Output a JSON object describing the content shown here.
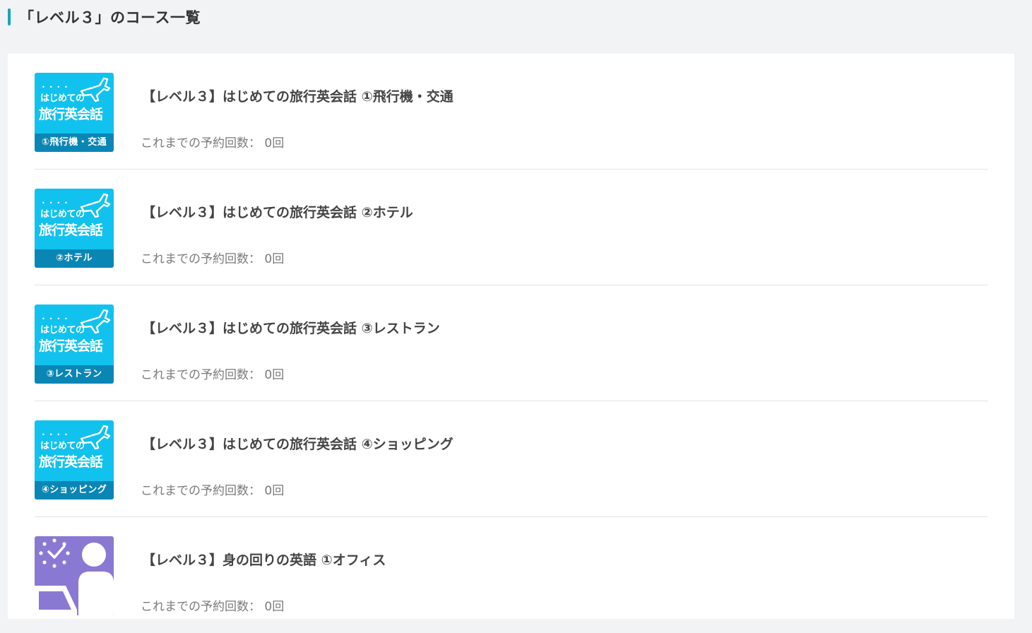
{
  "header": {
    "title": "「レベル３」のコース一覧"
  },
  "colors": {
    "accent": "#1aa3b8",
    "travel_thumb": "#12c2ee",
    "travel_band": "#0a86b5",
    "office_thumb": "#8a79d3"
  },
  "courses": [
    {
      "title": "【レベル３】はじめての旅行英会話 ①飛行機・交通",
      "reservations_label": "これまでの予約回数：",
      "reservations_count": "0回",
      "thumb": {
        "type": "travel",
        "top": "はじめての",
        "main": "旅行英会話",
        "band": "①飛行機・交通",
        "icon": "airplane-icon"
      }
    },
    {
      "title": "【レベル３】はじめての旅行英会話 ②ホテル",
      "reservations_label": "これまでの予約回数：",
      "reservations_count": "0回",
      "thumb": {
        "type": "travel",
        "top": "はじめての",
        "main": "旅行英会話",
        "band": "②ホテル",
        "icon": "airplane-icon"
      }
    },
    {
      "title": "【レベル３】はじめての旅行英会話 ③レストラン",
      "reservations_label": "これまでの予約回数：",
      "reservations_count": "0回",
      "thumb": {
        "type": "travel",
        "top": "はじめての",
        "main": "旅行英会話",
        "band": "③レストラン",
        "icon": "airplane-icon"
      }
    },
    {
      "title": "【レベル３】はじめての旅行英会話 ④ショッピング",
      "reservations_label": "これまでの予約回数：",
      "reservations_count": "0回",
      "thumb": {
        "type": "travel",
        "top": "はじめての",
        "main": "旅行英会話",
        "band": "④ショッピング",
        "icon": "airplane-icon"
      }
    },
    {
      "title": "【レベル３】身の回りの英語 ①オフィス",
      "reservations_label": "これまでの予約回数：",
      "reservations_count": "0回",
      "thumb": {
        "type": "office",
        "icon": "office-worker-icon"
      }
    }
  ]
}
